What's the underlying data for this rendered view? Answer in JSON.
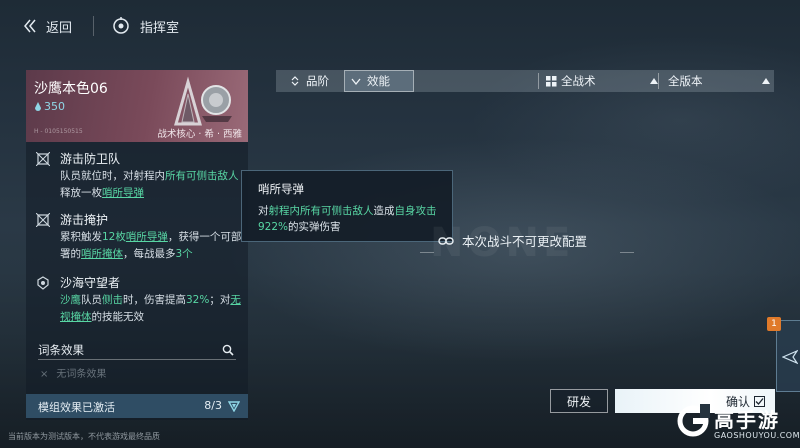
{
  "topbar": {
    "back_label": "返回",
    "command_label": "指挥室"
  },
  "card": {
    "title": "沙鹰本色06",
    "cost": "350",
    "tag": "战术核心 · 希 · 西雅",
    "tiny_text": "H - 0105150515"
  },
  "skills": [
    {
      "name": "游击防卫队",
      "desc_parts": [
        "队员就位时，对射程内",
        "所有可侧击敌人",
        "释放一枚",
        "哨所导弹"
      ]
    },
    {
      "name": "游击掩护",
      "desc_parts": [
        "累积触发",
        "12枚",
        "哨所导弹",
        "，获得一个可部署的",
        "哨所掩体",
        "，每战最多",
        "3个"
      ]
    },
    {
      "name": "沙海守望者",
      "desc_parts": [
        "沙鹰",
        "队员",
        "侧击",
        "时，伤害提高",
        "32%",
        "；对",
        "无视掩体",
        "的技能无效"
      ]
    }
  ],
  "entries": {
    "label": "词条效果",
    "empty_bullet": "×",
    "empty_text": "无词条效果"
  },
  "module": {
    "label": "模组效果已激活",
    "count": "8/3"
  },
  "footer_note": "当前版本为测试版本，不代表游戏最终品质",
  "tooltip": {
    "title": "哨所导弹",
    "desc_parts": [
      "对",
      "射程内所有可侧击敌人",
      "造成",
      "自身攻击922%",
      "的实弹伤害"
    ]
  },
  "filters": {
    "grade_label": "品阶",
    "efficacy_label": "效能",
    "tactic_label": "全战术",
    "version_label": "全版本"
  },
  "locked_message": "本次战斗不可更改配置",
  "watermark_text": "NONE",
  "buttons": {
    "research": "研发",
    "confirm": "确认"
  },
  "side_badge": "1",
  "logo": {
    "main": "高手游",
    "sub": "GAOSHOUYOU.COM"
  },
  "colors": {
    "accent_green": "#58d6a4",
    "card_header": "#7a4a5a",
    "module_bar": "#34566e"
  }
}
